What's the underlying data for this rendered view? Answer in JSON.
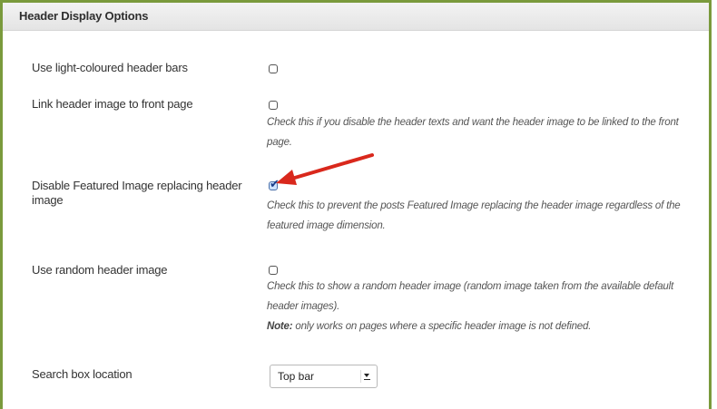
{
  "panel": {
    "title": "Header Display Options"
  },
  "options": [
    {
      "label": "Use light-coloured header bars",
      "checked": false
    },
    {
      "label": "Link header image to front page",
      "checked": false,
      "desc_lines": [
        "Check this if you disable the header texts and want the header image to be linked to the front",
        "page."
      ]
    },
    {
      "label_lines": [
        "Disable Featured Image replacing header",
        "image"
      ],
      "checked": true,
      "desc_lines": [
        "Check this to prevent the posts Featured Image replacing the header image regardless of the",
        "featured image dimension."
      ]
    },
    {
      "label": "Use random header image",
      "checked": false,
      "desc_lines": [
        "Check this to show a random header image (random image taken from the available default",
        "header images)."
      ],
      "note_label": "Note:",
      "note_text": " only works on pages where a specific header image is not defined."
    }
  ],
  "search_box": {
    "label": "Search box location",
    "selected": "Top bar"
  },
  "colors": {
    "frame": "#7a9a3c",
    "annotation_arrow": "#d9281c"
  }
}
